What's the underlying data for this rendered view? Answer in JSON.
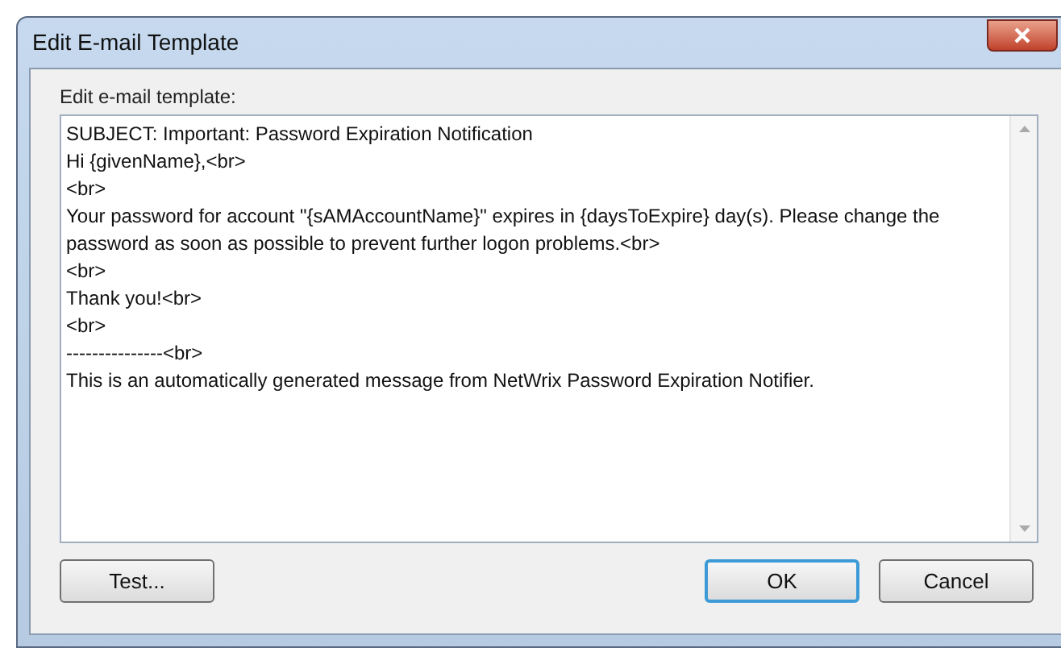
{
  "window": {
    "title": "Edit E-mail Template"
  },
  "editor": {
    "label": "Edit e-mail template:",
    "lines": [
      "SUBJECT: Important: Password Expiration Notification",
      "Hi {givenName},<br>",
      "<br>",
      "Your password for account \"{sAMAccountName}\" expires in {daysToExpire} day(s). Please change the password as soon as possible to prevent further logon problems.<br>",
      "<br>",
      "Thank you!<br>",
      "<br>",
      "---------------<br>",
      "This is an automatically generated message from NetWrix Password Expiration Notifier."
    ]
  },
  "buttons": [
    {
      "label": "Test...",
      "default": false
    },
    {
      "label": "OK",
      "default": true
    },
    {
      "label": "Cancel",
      "default": false
    }
  ]
}
